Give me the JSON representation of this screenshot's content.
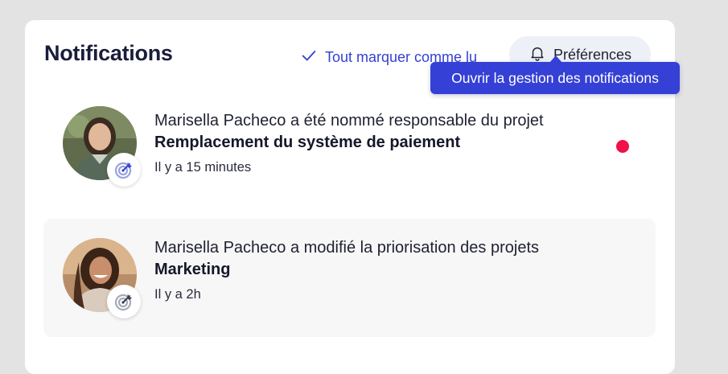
{
  "header": {
    "title": "Notifications",
    "mark_all_label": "Tout marquer comme lu",
    "preferences_label": "Préférences",
    "tooltip": "Ouvrir la gestion des notifications"
  },
  "notifications": [
    {
      "message": "Marisella Pacheco a été nommé responsable du projet",
      "subject": "Remplacement du système de paiement",
      "time": "Il y a 15 minutes",
      "unread": true,
      "badge_icon": "target-icon"
    },
    {
      "message": "Marisella Pacheco a modifié la priorisation des projets",
      "subject": "Marketing",
      "time": "Il y a 2h",
      "unread": false,
      "badge_icon": "target-icon"
    }
  ],
  "colors": {
    "accent": "#3442d1",
    "tooltip_bg": "#3540d6",
    "unread_dot": "#f0104a",
    "title": "#1a1d3a"
  }
}
